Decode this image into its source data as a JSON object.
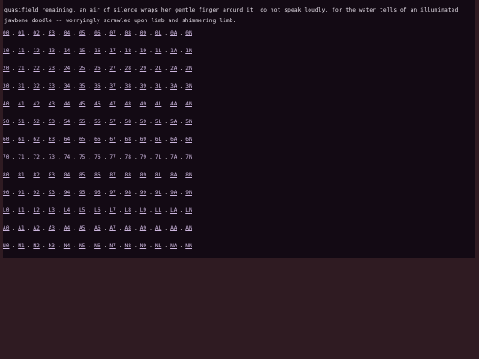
{
  "text": {
    "line": "quasifield remaining, an air of silence wraps her gentle finger around it. do not speak loudly, for the water tells of an illuminated jawbone doodle -- worryingly scrawled upon limb and shimmering limb."
  },
  "rows": [
    [
      "00",
      "01",
      "02",
      "03",
      "04",
      "05",
      "06",
      "07",
      "08",
      "09",
      "0L",
      "0A",
      "0N"
    ],
    [
      "10",
      "11",
      "12",
      "13",
      "14",
      "15",
      "16",
      "17",
      "18",
      "19",
      "1L",
      "1A",
      "1N"
    ],
    [
      "20",
      "21",
      "22",
      "23",
      "24",
      "25",
      "26",
      "27",
      "28",
      "29",
      "2L",
      "2A",
      "2N"
    ],
    [
      "30",
      "31",
      "32",
      "33",
      "34",
      "35",
      "36",
      "37",
      "38",
      "39",
      "3L",
      "3A",
      "3N"
    ],
    [
      "40",
      "41",
      "42",
      "43",
      "44",
      "45",
      "46",
      "47",
      "48",
      "49",
      "4L",
      "4A",
      "4N"
    ],
    [
      "50",
      "51",
      "52",
      "53",
      "54",
      "55",
      "56",
      "57",
      "58",
      "59",
      "5L",
      "5A",
      "5N"
    ],
    [
      "60",
      "61",
      "62",
      "63",
      "64",
      "65",
      "66",
      "67",
      "68",
      "69",
      "6L",
      "6A",
      "6N"
    ],
    [
      "70",
      "71",
      "72",
      "73",
      "74",
      "75",
      "76",
      "77",
      "78",
      "79",
      "7L",
      "7A",
      "7N"
    ],
    [
      "80",
      "81",
      "82",
      "83",
      "84",
      "85",
      "86",
      "87",
      "88",
      "89",
      "8L",
      "8A",
      "8N"
    ],
    [
      "90",
      "91",
      "92",
      "93",
      "94",
      "95",
      "96",
      "97",
      "98",
      "99",
      "9L",
      "9A",
      "9N"
    ],
    [
      "L0",
      "L1",
      "L2",
      "L3",
      "L4",
      "L5",
      "L6",
      "L7",
      "L8",
      "L9",
      "LL",
      "LA",
      "LN"
    ],
    [
      "A0",
      "A1",
      "A2",
      "A3",
      "A4",
      "A5",
      "A6",
      "A7",
      "A8",
      "A9",
      "AL",
      "AA",
      "AN"
    ],
    [
      "N0",
      "N1",
      "N2",
      "N3",
      "N4",
      "N5",
      "N6",
      "N7",
      "N8",
      "N9",
      "NL",
      "NA",
      "NN"
    ]
  ],
  "separator": "."
}
